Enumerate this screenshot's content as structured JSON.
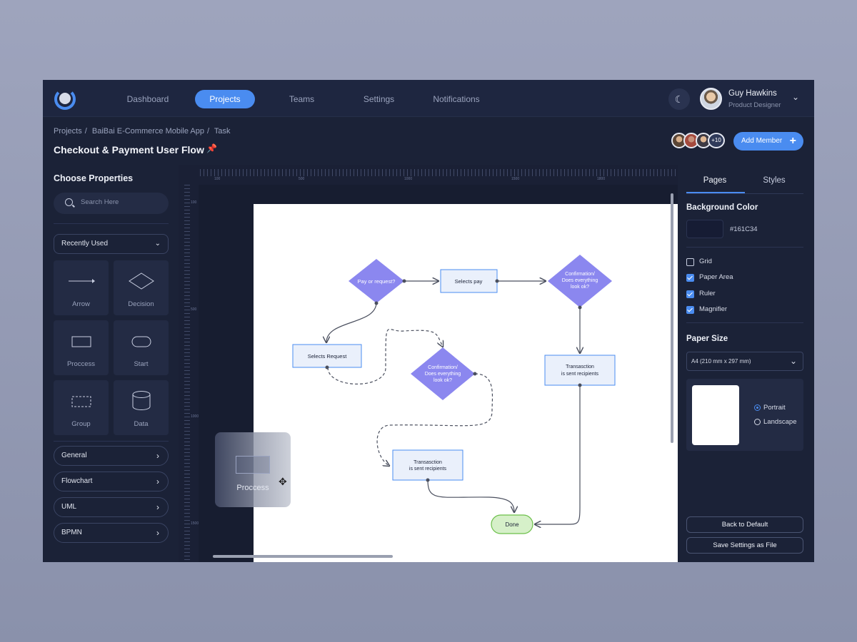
{
  "nav": {
    "items": [
      "Dashboard",
      "Projects",
      "Teams",
      "Settings",
      "Notifications"
    ],
    "active": "Projects"
  },
  "user": {
    "name": "Guy Hawkins",
    "role": "Product Designer"
  },
  "breadcrumb": [
    "Projects",
    "BaiBai E-Commerce Mobile App",
    "Task"
  ],
  "page_title": "Checkout & Payment User Flow",
  "members": {
    "more_count": "+10",
    "add_label": "Add Member"
  },
  "left_panel": {
    "title": "Choose Properties",
    "search_placeholder": "Search Here",
    "dropdown_value": "Recently Used",
    "shapes": [
      "Arrow",
      "Decision",
      "Proccess",
      "Start",
      "Group",
      "Data"
    ],
    "categories": [
      "General",
      "Flowchart",
      "UML",
      "BPMN"
    ]
  },
  "canvas": {
    "ruler_top": [
      "100",
      "500",
      "1000",
      "1500",
      "1800"
    ],
    "ruler_left": [
      "100",
      "500",
      "1000",
      "1500"
    ],
    "drag_ghost_label": "Proccess",
    "nodes": {
      "pay_or_request": "Pay or request?",
      "selects_pay": "Selects pay",
      "confirm_1": [
        "Confirmation/",
        "Does everything",
        "look ok?"
      ],
      "selects_request": "Selects Request",
      "confirm_2": [
        "Confirmation/",
        "Does everything",
        "look ok?"
      ],
      "transaction_1": [
        "Transasction",
        "is sent recipients"
      ],
      "transaction_2": [
        "Transasction",
        "is sent recipients"
      ],
      "done": "Done"
    }
  },
  "right_panel": {
    "tabs": [
      "Pages",
      "Styles"
    ],
    "active_tab": "Pages",
    "bg_color_title": "Background Color",
    "bg_color_hex": "#161C34",
    "bg_color": "#161c34",
    "toggles": [
      {
        "label": "Grid",
        "checked": false
      },
      {
        "label": "Paper Area",
        "checked": true
      },
      {
        "label": "Ruler",
        "checked": true
      },
      {
        "label": "Magnifier",
        "checked": true
      }
    ],
    "paper_size_title": "Paper Size",
    "paper_size_value": "A4 (210 mm x 297 mm)",
    "orientation": {
      "options": [
        "Portrait",
        "Landscape"
      ],
      "selected": "Portrait"
    },
    "buttons": {
      "reset": "Back to Default",
      "save": "Save Settings as File"
    }
  },
  "colors": {
    "accent": "#4a8cf0",
    "node_fill": "#8b87ef",
    "box_fill": "#eaf0fb",
    "done_fill": "#d6f0c9"
  }
}
